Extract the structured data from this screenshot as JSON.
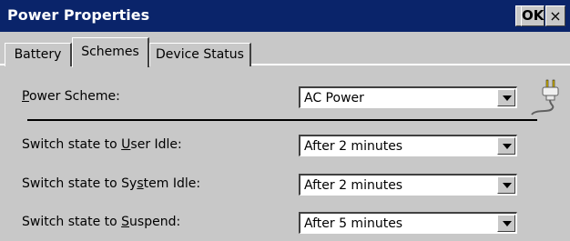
{
  "window": {
    "title": "Power Properties",
    "help_label": "?",
    "ok_label": "OK",
    "close_label": "×"
  },
  "tabs": [
    {
      "label": "Battery",
      "selected": false
    },
    {
      "label": "Schemes",
      "selected": true
    },
    {
      "label": "Device Status",
      "selected": false
    }
  ],
  "power_scheme": {
    "label_prefix": "",
    "label_ul": "P",
    "label_rest": "ower Scheme:",
    "value": "AC Power",
    "icon": "power-plug-icon"
  },
  "settings": [
    {
      "label_prefix": "Switch state to ",
      "label_ul": "U",
      "label_rest": "ser Idle:",
      "value": "After 2 minutes"
    },
    {
      "label_prefix": "Switch state to Sy",
      "label_ul": "s",
      "label_rest": "tem Idle:",
      "value": "After 2 minutes"
    },
    {
      "label_prefix": "Switch state to ",
      "label_ul": "S",
      "label_rest": "uspend:",
      "value": "After 5 minutes"
    }
  ],
  "colors": {
    "titlebar": "#0a246a",
    "face": "#c8c8c8"
  }
}
